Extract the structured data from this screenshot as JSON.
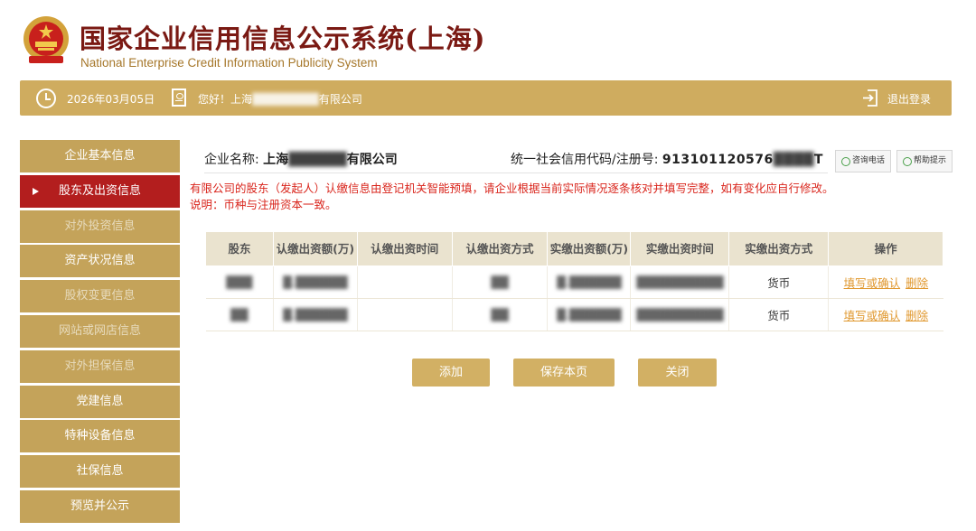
{
  "header": {
    "title_cn": "国家企业信用信息公示系统(上海)",
    "title_en": "National Enterprise Credit Information Publicity System"
  },
  "topbar": {
    "date": "2026年03月05日",
    "greeting": "您好！上海",
    "greeting_suffix": "有限公司",
    "logout": "退出登录"
  },
  "sidebar": {
    "items": [
      {
        "label": "企业基本信息",
        "state": "normal"
      },
      {
        "label": "股东及出资信息",
        "state": "active"
      },
      {
        "label": "对外投资信息",
        "state": "disabled"
      },
      {
        "label": "资产状况信息",
        "state": "normal"
      },
      {
        "label": "股权变更信息",
        "state": "disabled"
      },
      {
        "label": "网站或网店信息",
        "state": "disabled"
      },
      {
        "label": "对外担保信息",
        "state": "disabled"
      },
      {
        "label": "党建信息",
        "state": "normal"
      },
      {
        "label": "特种设备信息",
        "state": "normal"
      },
      {
        "label": "社保信息",
        "state": "normal"
      },
      {
        "label": "预览并公示",
        "state": "normal"
      }
    ]
  },
  "company": {
    "name_label": "企业名称:",
    "name_prefix": "上海",
    "name_suffix": "有限公司",
    "credit_label": "统一社会信用代码/注册号:",
    "credit_prefix": "913101120576",
    "credit_suffix": "T"
  },
  "tools": {
    "consult": "咨询电话",
    "help": "帮助提示"
  },
  "notice": {
    "line1": "有限公司的股东（发起人）认缴信息由登记机关智能预填，请企业根据当前实际情况逐条核对并填写完整，如有变化应自行修改。",
    "line2": "说明：币种与注册资本一致。"
  },
  "table": {
    "headers": [
      "股东",
      "认缴出资额(万)",
      "认缴出资时间",
      "认缴出资方式",
      "实缴出资额(万)",
      "实缴出资时间",
      "实缴出资方式",
      "操作"
    ],
    "rows": [
      {
        "paid_method": "货币",
        "fill": "填写或确认",
        "delete": "删除"
      },
      {
        "paid_method": "货币",
        "fill": "填写或确认",
        "delete": "删除"
      }
    ]
  },
  "buttons": {
    "add": "添加",
    "save": "保存本页",
    "close": "关闭"
  },
  "colors": {
    "gold": "#cfac5f",
    "active_red": "#b31e1e",
    "title_red": "#7a1913",
    "notice_red": "#d9251c",
    "link_orange": "#e0982f"
  }
}
